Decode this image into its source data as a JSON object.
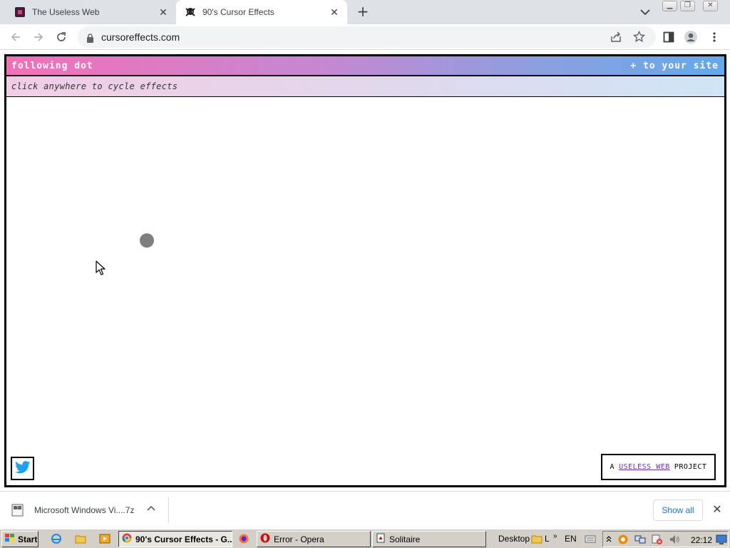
{
  "browser": {
    "tabs": [
      {
        "title": "The Useless Web",
        "active": false
      },
      {
        "title": "90's Cursor Effects",
        "active": true
      }
    ],
    "url": "cursoreffects.com"
  },
  "page": {
    "effect_name": "following dot",
    "add_to_site": "+ to your site",
    "hint": "click anywhere to cycle effects",
    "footer_prefix": "A",
    "footer_link": "USELESS WEB",
    "footer_suffix": "PROJECT"
  },
  "downloads": {
    "file_name": "Microsoft Windows Vi....7z",
    "show_all": "Show all"
  },
  "taskbar": {
    "start": "Start",
    "windows": [
      {
        "title": "90's Cursor Effects - G...",
        "active": true
      },
      {
        "title": "Error - Opera",
        "active": false
      },
      {
        "title": "Solitaire",
        "active": false
      }
    ],
    "desktop": "Desktop",
    "tray_letter": "L",
    "language": "EN",
    "clock": "22:12"
  },
  "colors": {
    "header_gradient_start": "#f36fb8",
    "header_gradient_end": "#64a9eb",
    "dot": "#7f7f7f",
    "link": "#6a2fb4",
    "twitter": "#1da1f2"
  },
  "icons": [
    "back-icon",
    "forward-icon",
    "reload-icon",
    "lock-icon",
    "share-icon",
    "star-icon",
    "sidepanel-icon",
    "profile-icon",
    "menu-icon",
    "twitter-icon"
  ]
}
